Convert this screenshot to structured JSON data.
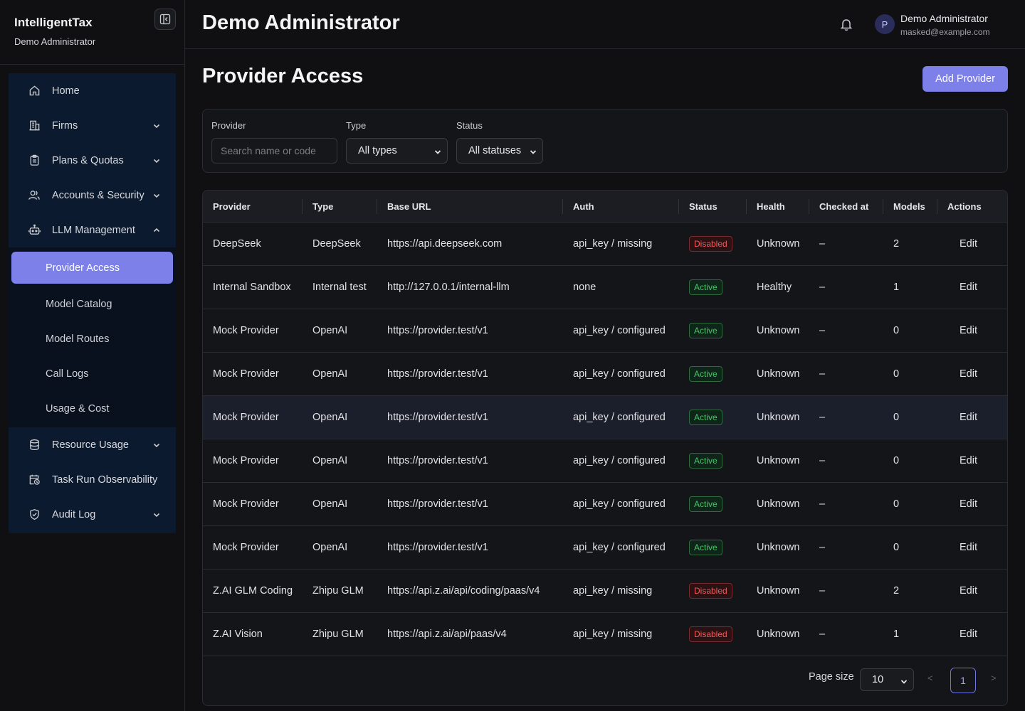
{
  "app": {
    "name": "IntelligentTax",
    "subtitle": "Demo Administrator"
  },
  "header": {
    "title": "Demo Administrator",
    "user_initial": "P",
    "user_name": "Demo Administrator",
    "user_email": "masked@example.com"
  },
  "sidebar": {
    "items": [
      {
        "label": "Home",
        "icon": "home-icon"
      },
      {
        "label": "Firms",
        "icon": "building-icon",
        "chevron": "down"
      },
      {
        "label": "Plans & Quotas",
        "icon": "clipboard-icon",
        "chevron": "down"
      },
      {
        "label": "Accounts & Security",
        "icon": "users-icon",
        "chevron": "down"
      },
      {
        "label": "LLM Management",
        "icon": "robot-icon",
        "chevron": "up"
      },
      {
        "label": "Resource Usage",
        "icon": "database-icon",
        "chevron": "down"
      },
      {
        "label": "Task Run Observability",
        "icon": "calendar-clock-icon"
      },
      {
        "label": "Audit Log",
        "icon": "shield-check-icon",
        "chevron": "down"
      }
    ],
    "sub_items": [
      "Provider Access",
      "Model Catalog",
      "Model Routes",
      "Call Logs",
      "Usage & Cost"
    ],
    "active_sub": "Provider Access"
  },
  "page": {
    "title": "Provider Access",
    "add_button": "Add Provider"
  },
  "filters": {
    "provider_label": "Provider",
    "provider_placeholder": "Search name or code",
    "type_label": "Type",
    "type_value": "All types",
    "status_label": "Status",
    "status_value": "All statuses"
  },
  "table": {
    "columns": [
      "Provider",
      "Type",
      "Base URL",
      "Auth",
      "Status",
      "Health",
      "Checked at",
      "Models",
      "Actions"
    ],
    "rows": [
      {
        "provider": "DeepSeek",
        "type": "DeepSeek",
        "base_url": "https://api.deepseek.com",
        "auth": "api_key / missing",
        "status": "Disabled",
        "health": "Unknown",
        "checked_at": "–",
        "models": "2",
        "action": "Edit"
      },
      {
        "provider": "Internal Sandbox",
        "type": "Internal test",
        "base_url": "http://127.0.0.1/internal-llm",
        "auth": "none",
        "status": "Active",
        "health": "Healthy",
        "checked_at": "–",
        "models": "1",
        "action": "Edit"
      },
      {
        "provider": "Mock Provider",
        "type": "OpenAI",
        "base_url": "https://provider.test/v1",
        "auth": "api_key / configured",
        "status": "Active",
        "health": "Unknown",
        "checked_at": "–",
        "models": "0",
        "action": "Edit"
      },
      {
        "provider": "Mock Provider",
        "type": "OpenAI",
        "base_url": "https://provider.test/v1",
        "auth": "api_key / configured",
        "status": "Active",
        "health": "Unknown",
        "checked_at": "–",
        "models": "0",
        "action": "Edit"
      },
      {
        "provider": "Mock Provider",
        "type": "OpenAI",
        "base_url": "https://provider.test/v1",
        "auth": "api_key / configured",
        "status": "Active",
        "health": "Unknown",
        "checked_at": "–",
        "models": "0",
        "action": "Edit"
      },
      {
        "provider": "Mock Provider",
        "type": "OpenAI",
        "base_url": "https://provider.test/v1",
        "auth": "api_key / configured",
        "status": "Active",
        "health": "Unknown",
        "checked_at": "–",
        "models": "0",
        "action": "Edit"
      },
      {
        "provider": "Mock Provider",
        "type": "OpenAI",
        "base_url": "https://provider.test/v1",
        "auth": "api_key / configured",
        "status": "Active",
        "health": "Unknown",
        "checked_at": "–",
        "models": "0",
        "action": "Edit"
      },
      {
        "provider": "Mock Provider",
        "type": "OpenAI",
        "base_url": "https://provider.test/v1",
        "auth": "api_key / configured",
        "status": "Active",
        "health": "Unknown",
        "checked_at": "–",
        "models": "0",
        "action": "Edit"
      },
      {
        "provider": "Z.AI GLM Coding",
        "type": "Zhipu GLM",
        "base_url": "https://api.z.ai/api/coding/paas/v4",
        "auth": "api_key / missing",
        "status": "Disabled",
        "health": "Unknown",
        "checked_at": "–",
        "models": "2",
        "action": "Edit"
      },
      {
        "provider": "Z.AI Vision",
        "type": "Zhipu GLM",
        "base_url": "https://api.z.ai/api/paas/v4",
        "auth": "api_key / missing",
        "status": "Disabled",
        "health": "Unknown",
        "checked_at": "–",
        "models": "1",
        "action": "Edit"
      }
    ]
  },
  "pagination": {
    "page_size_label": "Page size",
    "page_size": "10",
    "current_page": "1",
    "prev": "<",
    "next": ">"
  },
  "colors": {
    "accent": "#7c80e8",
    "active": "#49c46a",
    "disabled": "#ef5b5b",
    "nav_bg": "#0b1a2e"
  }
}
